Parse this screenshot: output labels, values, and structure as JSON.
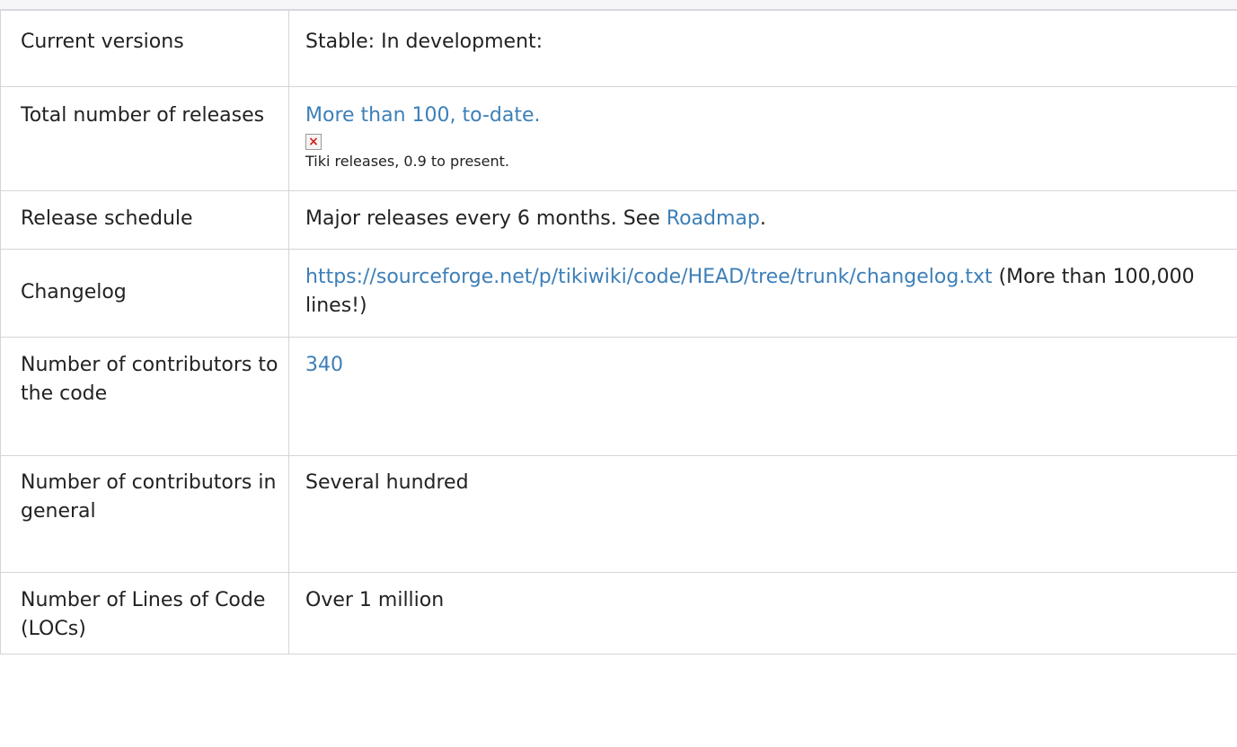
{
  "rows": {
    "versions": {
      "label": "Current versions",
      "value": "Stable: In development:"
    },
    "releases": {
      "label": "Total number of releases",
      "link": "More than 100, to-date.",
      "image_icon": "broken-image-icon",
      "caption": "Tiki releases, 0.9 to present."
    },
    "schedule": {
      "label": "Release schedule",
      "text": "Major releases every 6 months. See ",
      "link": "Roadmap",
      "suffix": "."
    },
    "changelog": {
      "label": "Changelog",
      "link": "https://sourceforge.net/p/tikiwiki/code/HEAD/tree/trunk/changelog.txt",
      "text": " (More than 100,000 lines!)"
    },
    "contributors_code": {
      "label": "Number of contributors to the code",
      "link": "340"
    },
    "contributors_general": {
      "label": "Number of contributors in general",
      "value": "Several hundred"
    },
    "loc": {
      "label": "Number of Lines of Code (LOCs)",
      "value": "Over 1 million"
    }
  },
  "colors": {
    "link": "#3d7fb8",
    "border": "#d4d5da",
    "text": "#222222"
  }
}
